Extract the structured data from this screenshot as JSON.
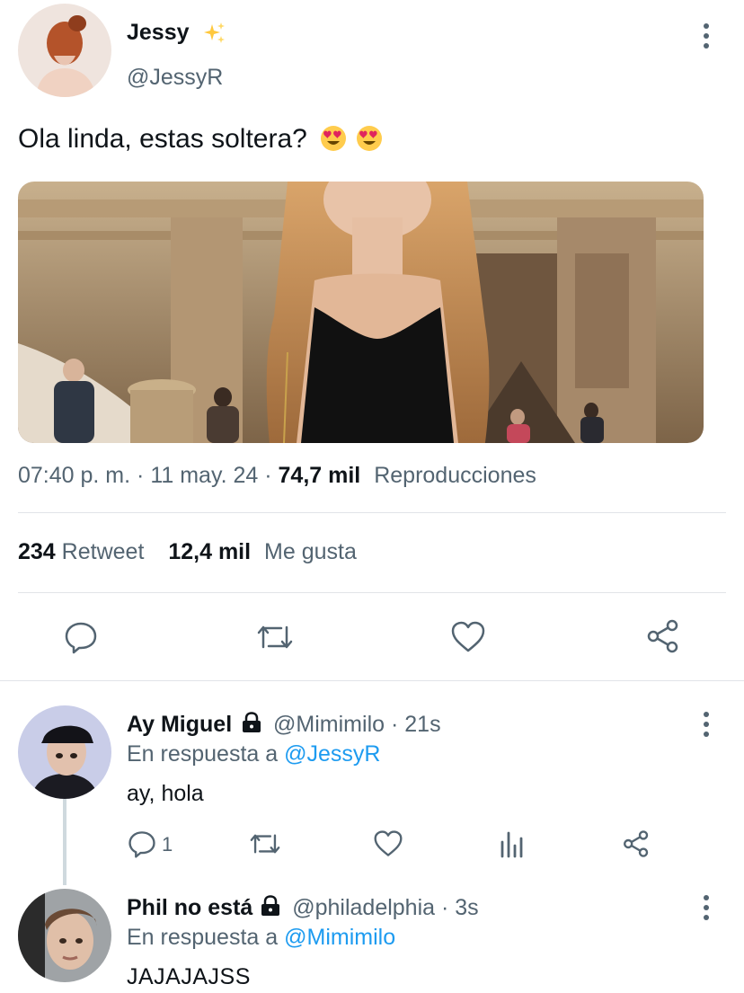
{
  "tweet": {
    "author_name": "Jessy",
    "author_badge": "✨",
    "author_handle": "@JessyR",
    "text": "Ola linda, estas soltera?",
    "emojis": [
      "heart-eyes",
      "heart-eyes"
    ],
    "time": "07:40 p. m.",
    "sep1": "·",
    "date": "11 may. 24",
    "sep2": "·",
    "views_count": "74,7 mil",
    "views_label": "Reproducciones",
    "retweets_count": "234",
    "retweets_label": "Retweet",
    "likes_count": "12,4 mil",
    "likes_label": "Me gusta"
  },
  "actions": [
    "reply-icon",
    "retweet-icon",
    "like-icon",
    "share-icon"
  ],
  "replies": [
    {
      "name": "Ay Miguel",
      "locked": true,
      "handle": "@Mimimilo",
      "dot": "·",
      "time": "21s",
      "reply_prefix": "En respuesta a",
      "reply_to": "@JessyR",
      "text": "ay, hola",
      "reply_count": "1"
    },
    {
      "name": "Phil no está",
      "locked": true,
      "handle": "@philadelphia",
      "dot": "·",
      "time": "3s",
      "reply_prefix": "En respuesta a",
      "reply_to": "@Mimimilo",
      "text": "JAJAJAJSS"
    }
  ],
  "colors": {
    "text": "#0f1419",
    "secondary": "#536471",
    "link": "#1d9bf0",
    "divider": "#e1e4e8"
  }
}
